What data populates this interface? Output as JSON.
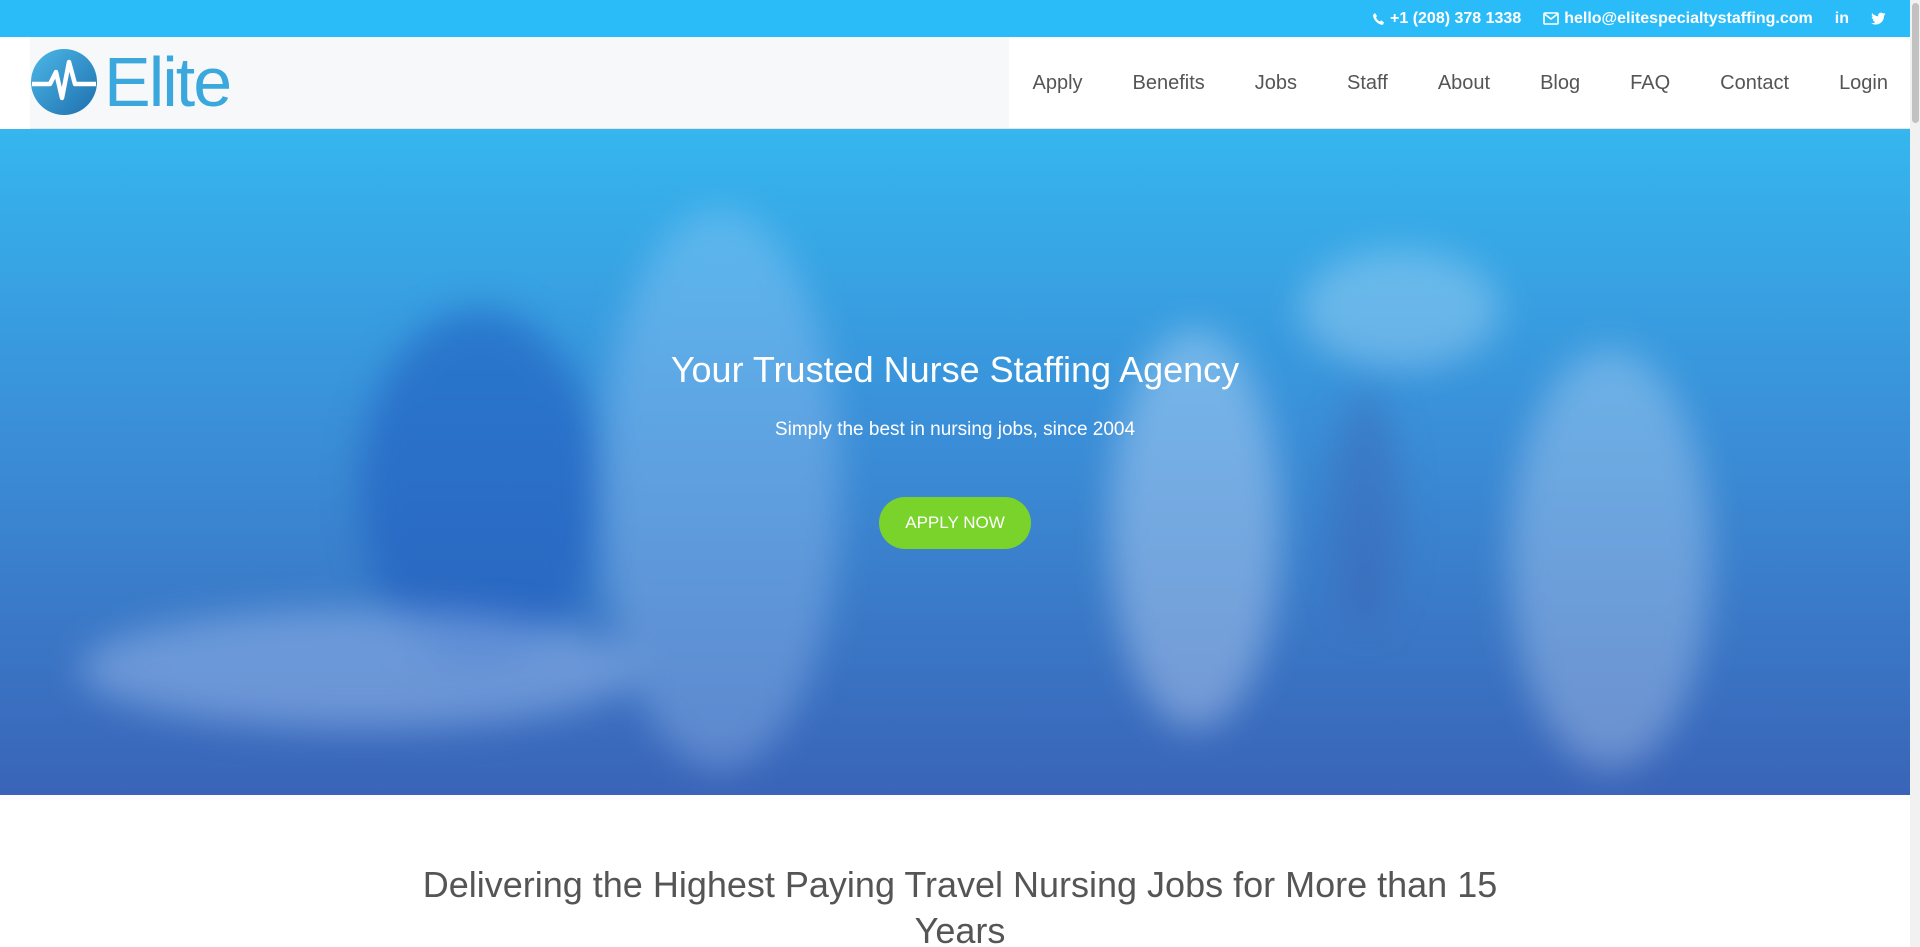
{
  "topbar": {
    "phone": "+1 (208) 378 1338",
    "email": "hello@elitespecialtystaffing.com",
    "linkedin_label": "in"
  },
  "logo": {
    "text": "Elite",
    "icon": "heartbeat-logo-icon"
  },
  "nav": [
    {
      "label": "Apply"
    },
    {
      "label": "Benefits"
    },
    {
      "label": "Jobs"
    },
    {
      "label": "Staff"
    },
    {
      "label": "About"
    },
    {
      "label": "Blog"
    },
    {
      "label": "FAQ"
    },
    {
      "label": "Contact"
    },
    {
      "label": "Login"
    }
  ],
  "hero": {
    "title": "Your Trusted Nurse Staffing Agency",
    "subtitle": "Simply the best in nursing jobs, since 2004",
    "cta": "APPLY NOW"
  },
  "section": {
    "heading": "Delivering the Highest Paying Travel Nursing Jobs for More than 15 Years"
  },
  "colors": {
    "topbar": "#29bcf9",
    "cta": "#79d32b",
    "brand": "#3aa7dd"
  }
}
